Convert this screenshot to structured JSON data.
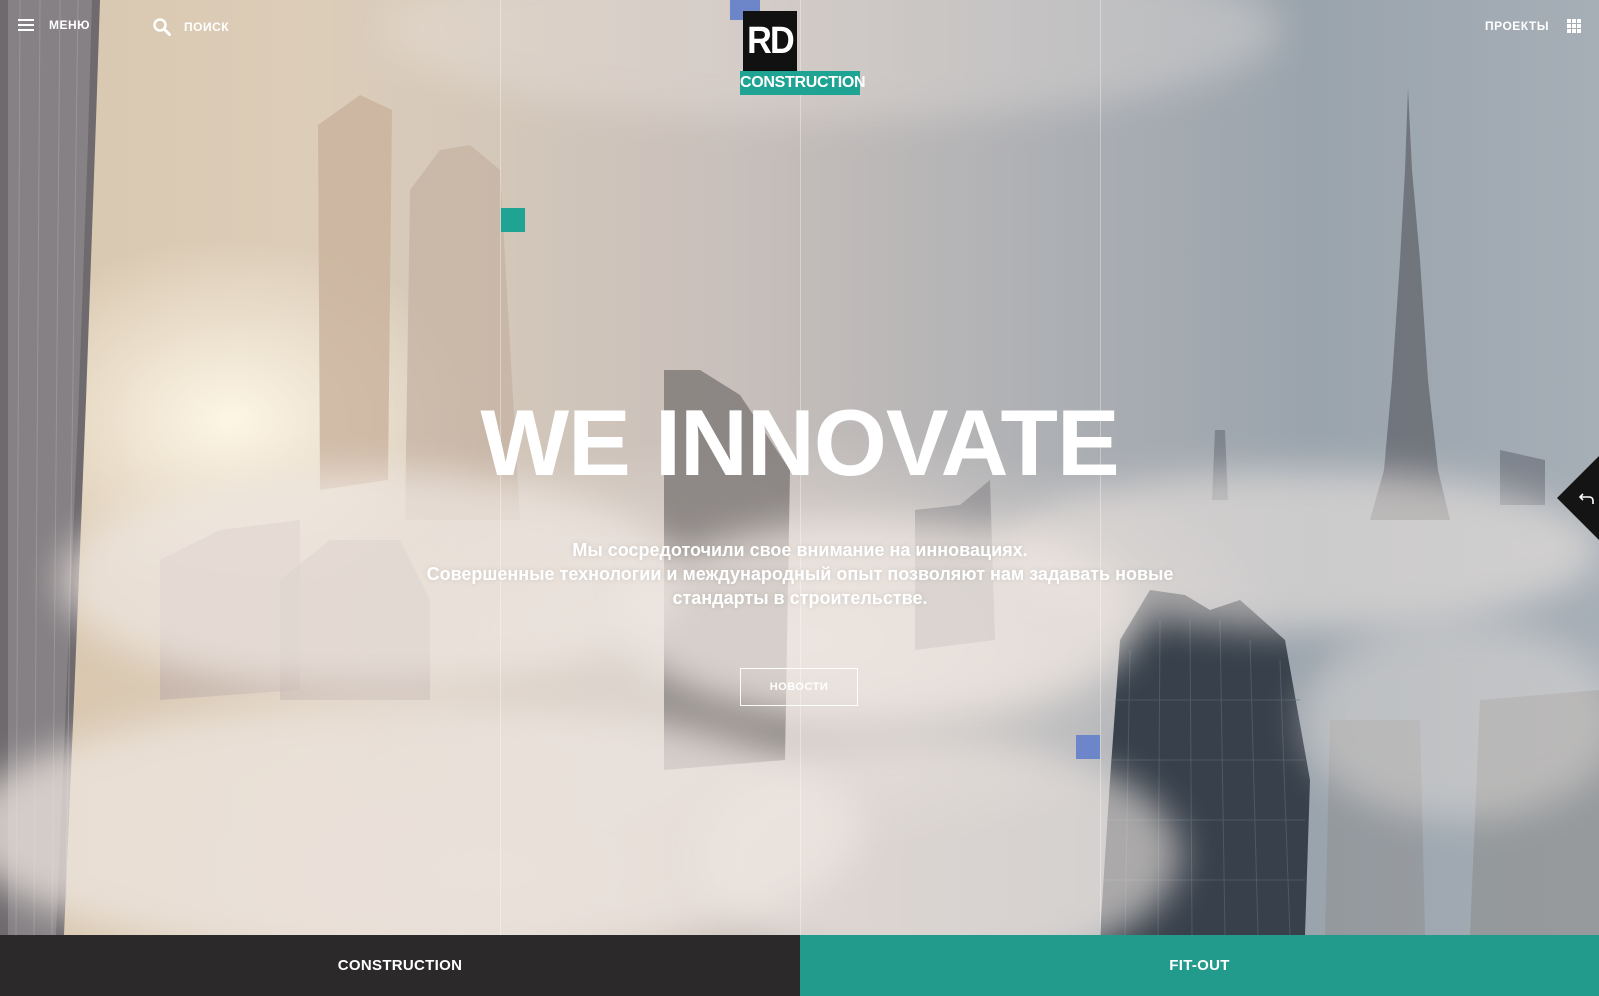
{
  "header": {
    "menu_label": "МЕНЮ",
    "search_label": "ПОИСК",
    "projects_label": "ПРОЕКТЫ"
  },
  "logo": {
    "mark": "RD",
    "subtitle": "CONSTRUCTION",
    "mark_color": "#111111",
    "subtitle_color": "#1fa393"
  },
  "hero": {
    "title": "WE INNOVATE",
    "text_line1": "Мы сосредоточили свое внимание на инновациях.",
    "text_line2": "Совершенные технологии и международный опыт позволяют нам задавать новые",
    "text_line3": "стандарты в строительстве.",
    "cta_label": "НОВОСТИ"
  },
  "bottom_nav": {
    "construction_label": "CONSTRUCTION",
    "fitout_label": "FIT-OUT",
    "construction_color": "#2b2929",
    "fitout_color": "#239b8c"
  },
  "icons": {
    "menu": "hamburger-icon",
    "search": "search-icon",
    "projects": "grid-icon",
    "back": "undo-arrow-icon"
  },
  "accents": {
    "teal": "#1fa393",
    "blue": "#6d86c9"
  }
}
